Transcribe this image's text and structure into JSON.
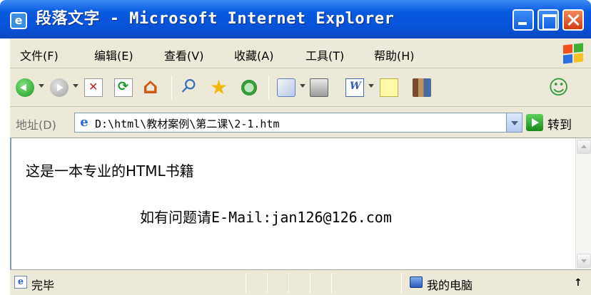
{
  "window": {
    "title": "段落文字 - Microsoft Internet Explorer",
    "icon": "ie-icon"
  },
  "menu": {
    "items": [
      "文件(F)",
      "编辑(E)",
      "查看(V)",
      "收藏(A)",
      "工具(T)",
      "帮助(H)"
    ]
  },
  "toolbar": {
    "icons": [
      "back-icon",
      "forward-icon",
      "stop-icon",
      "refresh-icon",
      "home-icon",
      "search-icon",
      "favorites-icon",
      "media-icon",
      "mail-icon",
      "print-icon",
      "word-icon",
      "note-icon",
      "research-icon",
      "messenger-icon"
    ]
  },
  "address": {
    "label": "地址(D)",
    "url": "D:\\html\\教材案例\\第二课\\2-1.htm",
    "go_label": "转到"
  },
  "content": {
    "line1": "这是一本专业的HTML书籍",
    "line2": "如有问题请E-Mail:jan126@126.com"
  },
  "status": {
    "text": "完毕",
    "zone": "我的电脑"
  },
  "colors": {
    "titlebar": "#0a5ae0",
    "chrome": "#ece9d8",
    "close_button": "#d43a10"
  }
}
